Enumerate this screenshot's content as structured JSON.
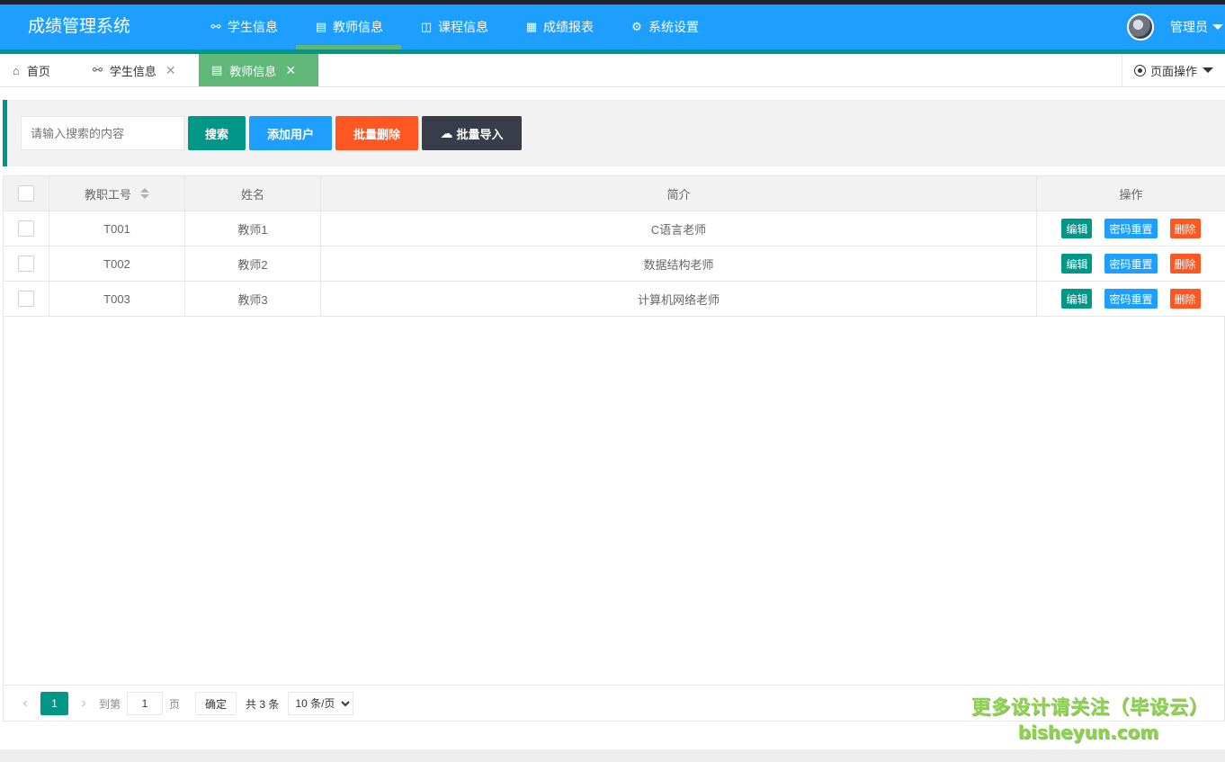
{
  "app": {
    "title": "成绩管理系统"
  },
  "nav": [
    {
      "label": "学生信息",
      "icon": "users-icon"
    },
    {
      "label": "教师信息",
      "icon": "clipboard-icon"
    },
    {
      "label": "课程信息",
      "icon": "book-icon"
    },
    {
      "label": "成绩报表",
      "icon": "table-icon"
    },
    {
      "label": "系统设置",
      "icon": "gear-icon"
    }
  ],
  "user": {
    "name": "管理员"
  },
  "tabs": [
    {
      "label": "首页",
      "icon": "home-icon"
    },
    {
      "label": "学生信息",
      "icon": "users-icon",
      "close": "✕"
    },
    {
      "label": "教师信息",
      "icon": "clipboard-icon",
      "close": "✕"
    }
  ],
  "page_ops": {
    "label": "页面操作"
  },
  "toolbar": {
    "search_placeholder": "请输入搜索的内容",
    "search": "搜索",
    "add": "添加用户",
    "batch_delete": "批量删除",
    "batch_import": "批量导入"
  },
  "table": {
    "columns": [
      "教职工号",
      "姓名",
      "简介",
      "操作"
    ],
    "rows": [
      {
        "id": "T001",
        "name": "教师1",
        "intro": "C语言老师"
      },
      {
        "id": "T002",
        "name": "教师2",
        "intro": "数据结构老师"
      },
      {
        "id": "T003",
        "name": "教师3",
        "intro": "计算机网络老师"
      }
    ],
    "actions": {
      "edit": "编辑",
      "reset": "密码重置",
      "delete": "删除"
    }
  },
  "pager": {
    "current": "1",
    "goto_label": "到第",
    "goto_value": "1",
    "page_unit": "页",
    "confirm": "确定",
    "total": "共 3 条",
    "limit": "10 条/页"
  },
  "watermark": {
    "line1": "更多设计请关注（毕设云）",
    "line2": "bisheyun.com"
  },
  "colors": {
    "header": "#1e9fff",
    "accent": "#009688",
    "active_tab": "#5fb878",
    "danger": "#ff5722",
    "dark": "#393d49"
  }
}
